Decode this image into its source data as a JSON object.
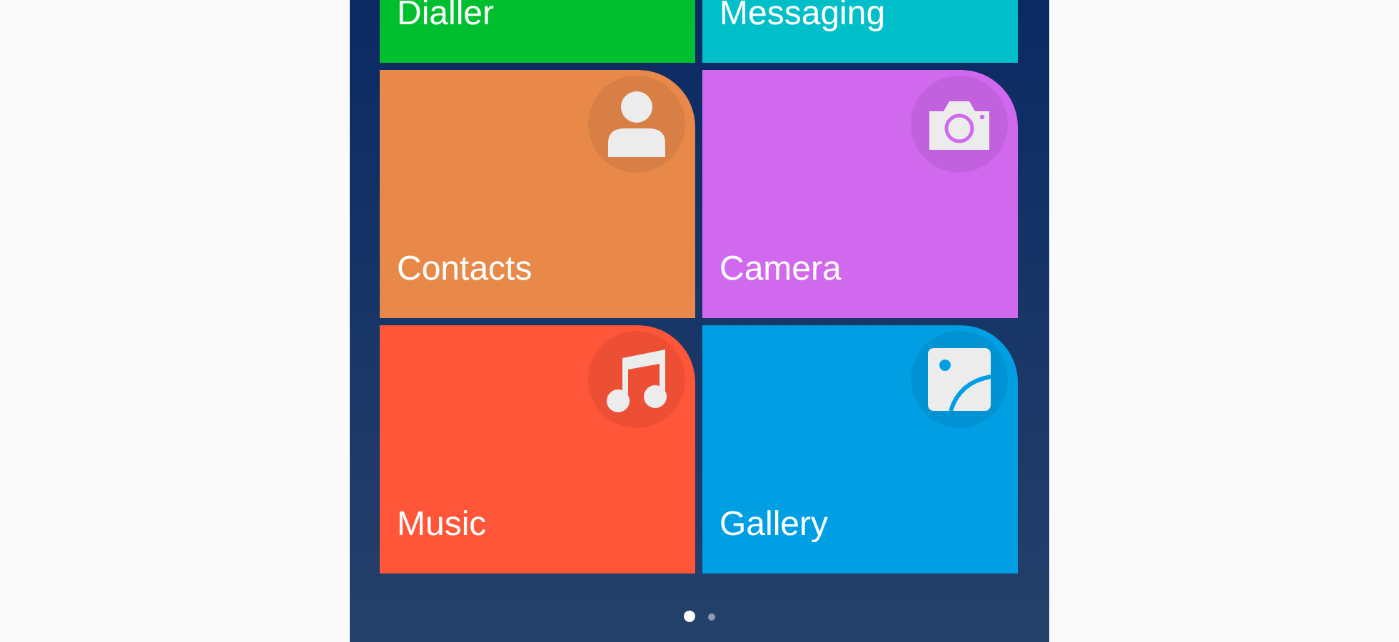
{
  "tiles": [
    {
      "label": "Dialler",
      "color": "#00bf2e"
    },
    {
      "label": "Messaging",
      "color": "#00bfc8"
    },
    {
      "label": "Contacts",
      "color": "#e8894a",
      "kind": "person"
    },
    {
      "label": "Camera",
      "color": "#d169ee",
      "kind": "camera"
    },
    {
      "label": "Music",
      "color": "#ff5538",
      "kind": "music"
    },
    {
      "label": "Gallery",
      "color": "#009fe3",
      "kind": "image"
    }
  ],
  "page_dots": [
    {
      "selected": true
    },
    {
      "selected": false
    }
  ]
}
